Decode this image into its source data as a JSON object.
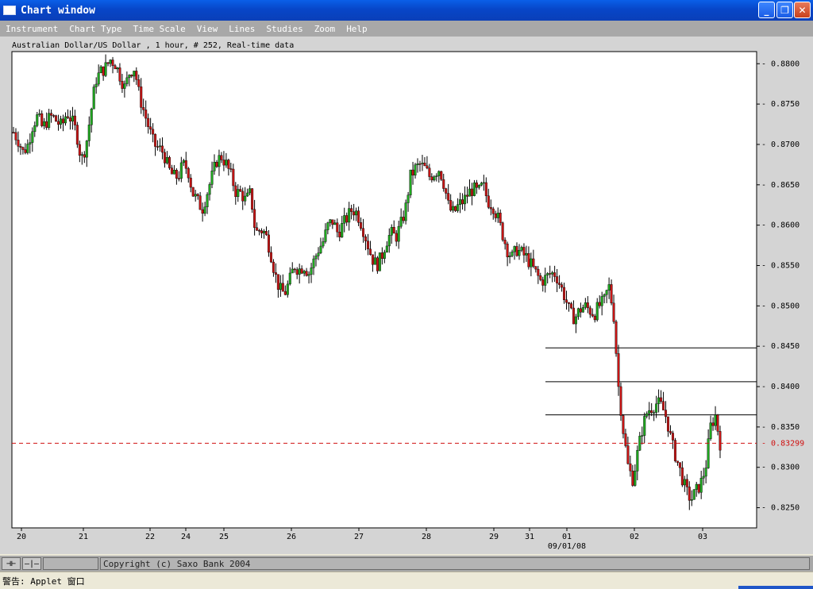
{
  "window": {
    "title": "Chart window",
    "minimize_icon": "minimize-icon",
    "restore_icon": "restore-icon",
    "close_icon": "close-icon",
    "minimize_glyph": "_",
    "restore_glyph": "❐",
    "close_glyph": "✕"
  },
  "menu": [
    "Instrument",
    "Chart Type",
    "Time Scale",
    "View",
    "Lines",
    "Studies",
    "Zoom",
    "Help"
  ],
  "chart_header": "Australian Dollar/US Dollar , 1 hour, # 252, Real-time data",
  "status": {
    "btn1": "⊣⊢",
    "btn2": "—|—",
    "copyright": "Copyright (c) Saxo Bank 2004"
  },
  "warning": "警告: Applet 窗口",
  "colors": {
    "bull": "#1fa81f",
    "bear": "#c81414",
    "axis_text": "#000000",
    "price_line": "#d01010"
  },
  "chart_data": {
    "type": "candlestick",
    "instrument": "Australian Dollar/US Dollar",
    "ylim": [
      0.8225,
      0.8815
    ],
    "y_ticks": [
      "0.8800",
      "0.8750",
      "0.8700",
      "0.8650",
      "0.8600",
      "0.8550",
      "0.8500",
      "0.8450",
      "0.8400",
      "0.8350",
      "0.8300",
      "0.8250"
    ],
    "x_ticks": [
      "20",
      "21",
      "22",
      "24",
      "25",
      "26",
      "27",
      "28",
      "29",
      "31",
      "01",
      "02",
      "03"
    ],
    "x_sub_label": "09/01/08",
    "last_price": 0.83299,
    "last_price_label": "0.83299",
    "horizontal_lines": [
      0.8448,
      0.8406,
      0.8365
    ],
    "close_path": [
      0.8715,
      0.8705,
      0.869,
      0.87,
      0.8725,
      0.8735,
      0.872,
      0.873,
      0.8735,
      0.8728,
      0.8722,
      0.874,
      0.873,
      0.8715,
      0.868,
      0.87,
      0.874,
      0.878,
      0.879,
      0.8795,
      0.8805,
      0.88,
      0.8785,
      0.877,
      0.879,
      0.8795,
      0.876,
      0.874,
      0.872,
      0.87,
      0.8695,
      0.869,
      0.867,
      0.866,
      0.866,
      0.8675,
      0.867,
      0.864,
      0.863,
      0.862,
      0.864,
      0.866,
      0.868,
      0.8685,
      0.8675,
      0.866,
      0.864,
      0.864,
      0.863,
      0.864,
      0.859,
      0.8595,
      0.859,
      0.857,
      0.854,
      0.852,
      0.8515,
      0.853,
      0.855,
      0.8545,
      0.855,
      0.854,
      0.8555,
      0.857,
      0.858,
      0.86,
      0.8605,
      0.859,
      0.86,
      0.861,
      0.862,
      0.8615,
      0.86,
      0.858,
      0.856,
      0.855,
      0.856,
      0.858,
      0.859,
      0.8585,
      0.86,
      0.862,
      0.866,
      0.867,
      0.8675,
      0.867,
      0.866,
      0.8665,
      0.867,
      0.865,
      0.862,
      0.8615,
      0.8625,
      0.863,
      0.864,
      0.8645,
      0.864,
      0.865,
      0.863,
      0.8625,
      0.861,
      0.859,
      0.857,
      0.856,
      0.857,
      0.8565,
      0.856,
      0.855,
      0.854,
      0.853,
      0.8535,
      0.854,
      0.854,
      0.8525,
      0.851,
      0.849,
      0.8485,
      0.8495,
      0.85,
      0.8495,
      0.849,
      0.85,
      0.8505,
      0.8525,
      0.849,
      0.84,
      0.8345,
      0.83,
      0.8285,
      0.832,
      0.835,
      0.837,
      0.8375,
      0.838,
      0.8375,
      0.836,
      0.833,
      0.831,
      0.829,
      0.827,
      0.826,
      0.827,
      0.828,
      0.83,
      0.835,
      0.8365,
      0.833
    ]
  }
}
